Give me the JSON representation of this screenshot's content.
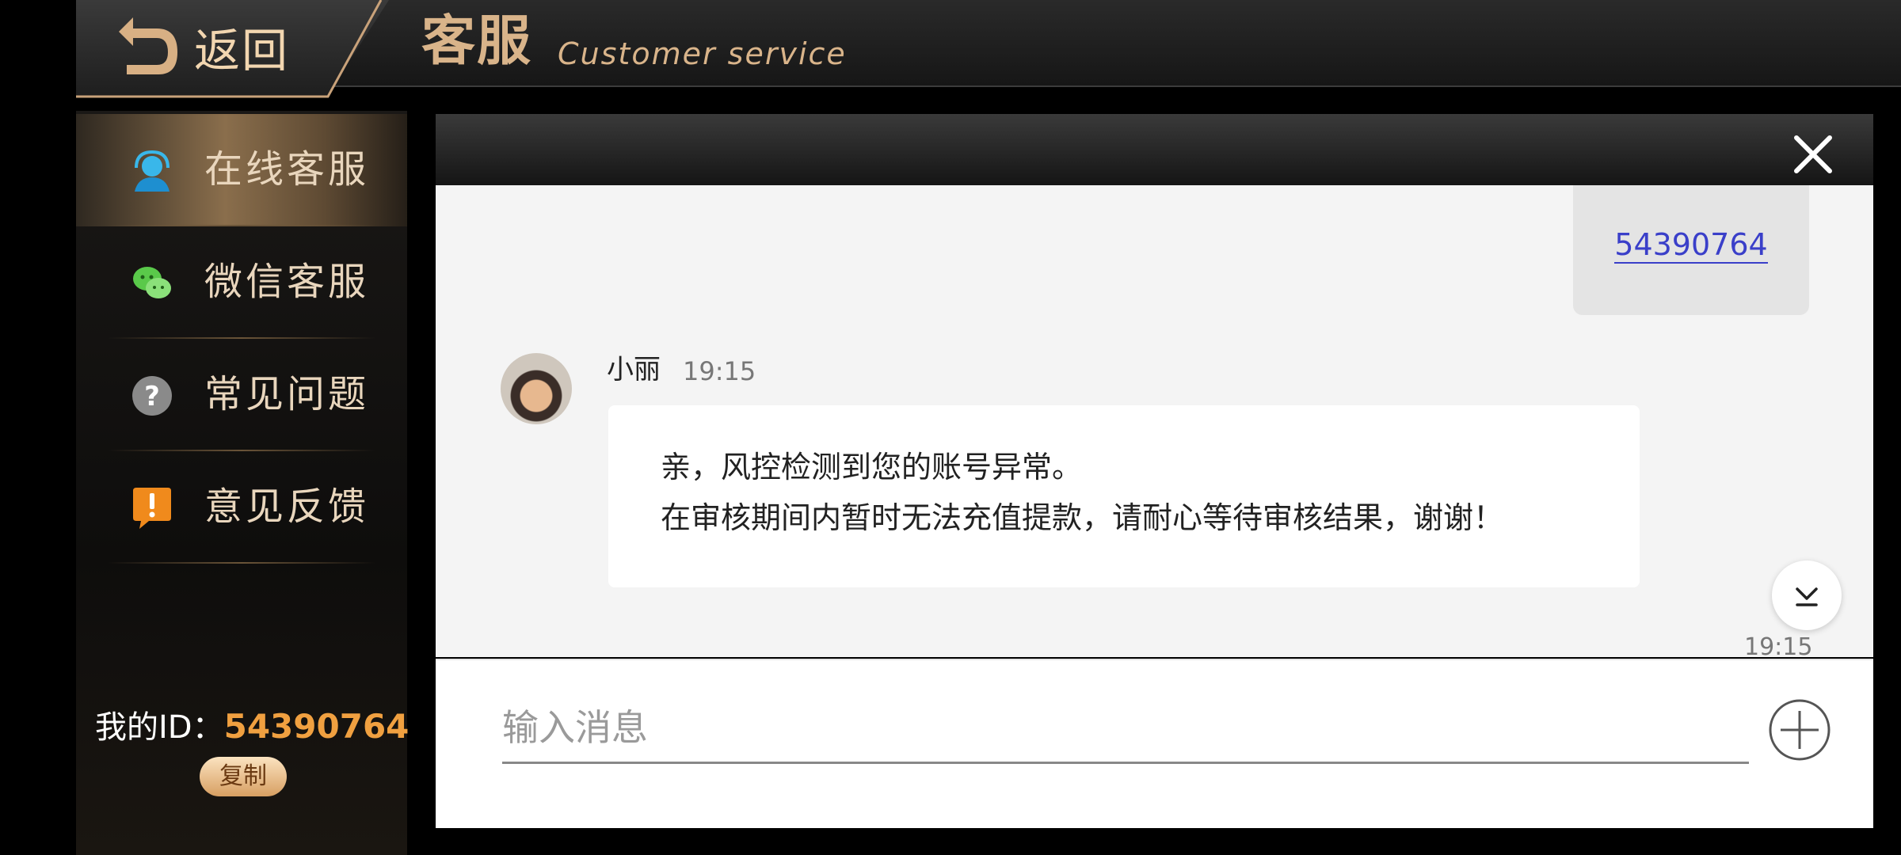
{
  "header": {
    "back_label": "返回",
    "title_cn": "客服",
    "title_en": "Customer service"
  },
  "sidebar": {
    "items": [
      {
        "label": "在线客服",
        "icon": "headset-user-icon",
        "active": true
      },
      {
        "label": "微信客服",
        "icon": "wechat-icon",
        "active": false
      },
      {
        "label": "常见问题",
        "icon": "question-icon",
        "active": false
      },
      {
        "label": "意见反馈",
        "icon": "feedback-exclamation-icon",
        "active": false
      }
    ],
    "my_id_label": "我的ID：",
    "my_id_value": "54390764",
    "copy_label": "复制"
  },
  "chat": {
    "my_message_link": "54390764",
    "agent_name": "小丽",
    "agent_time": "19:15",
    "message_line1": "亲，风控检测到您的账号异常。",
    "message_line2": "在审核期间内暂时无法充值提款，请耐心等待审核结果，谢谢！",
    "bottom_time": "19:15",
    "input_placeholder": "输入消息"
  },
  "colors": {
    "accent_gold": "#d9b48a",
    "id_orange": "#f0a040",
    "link_blue": "#3a3fc9"
  }
}
